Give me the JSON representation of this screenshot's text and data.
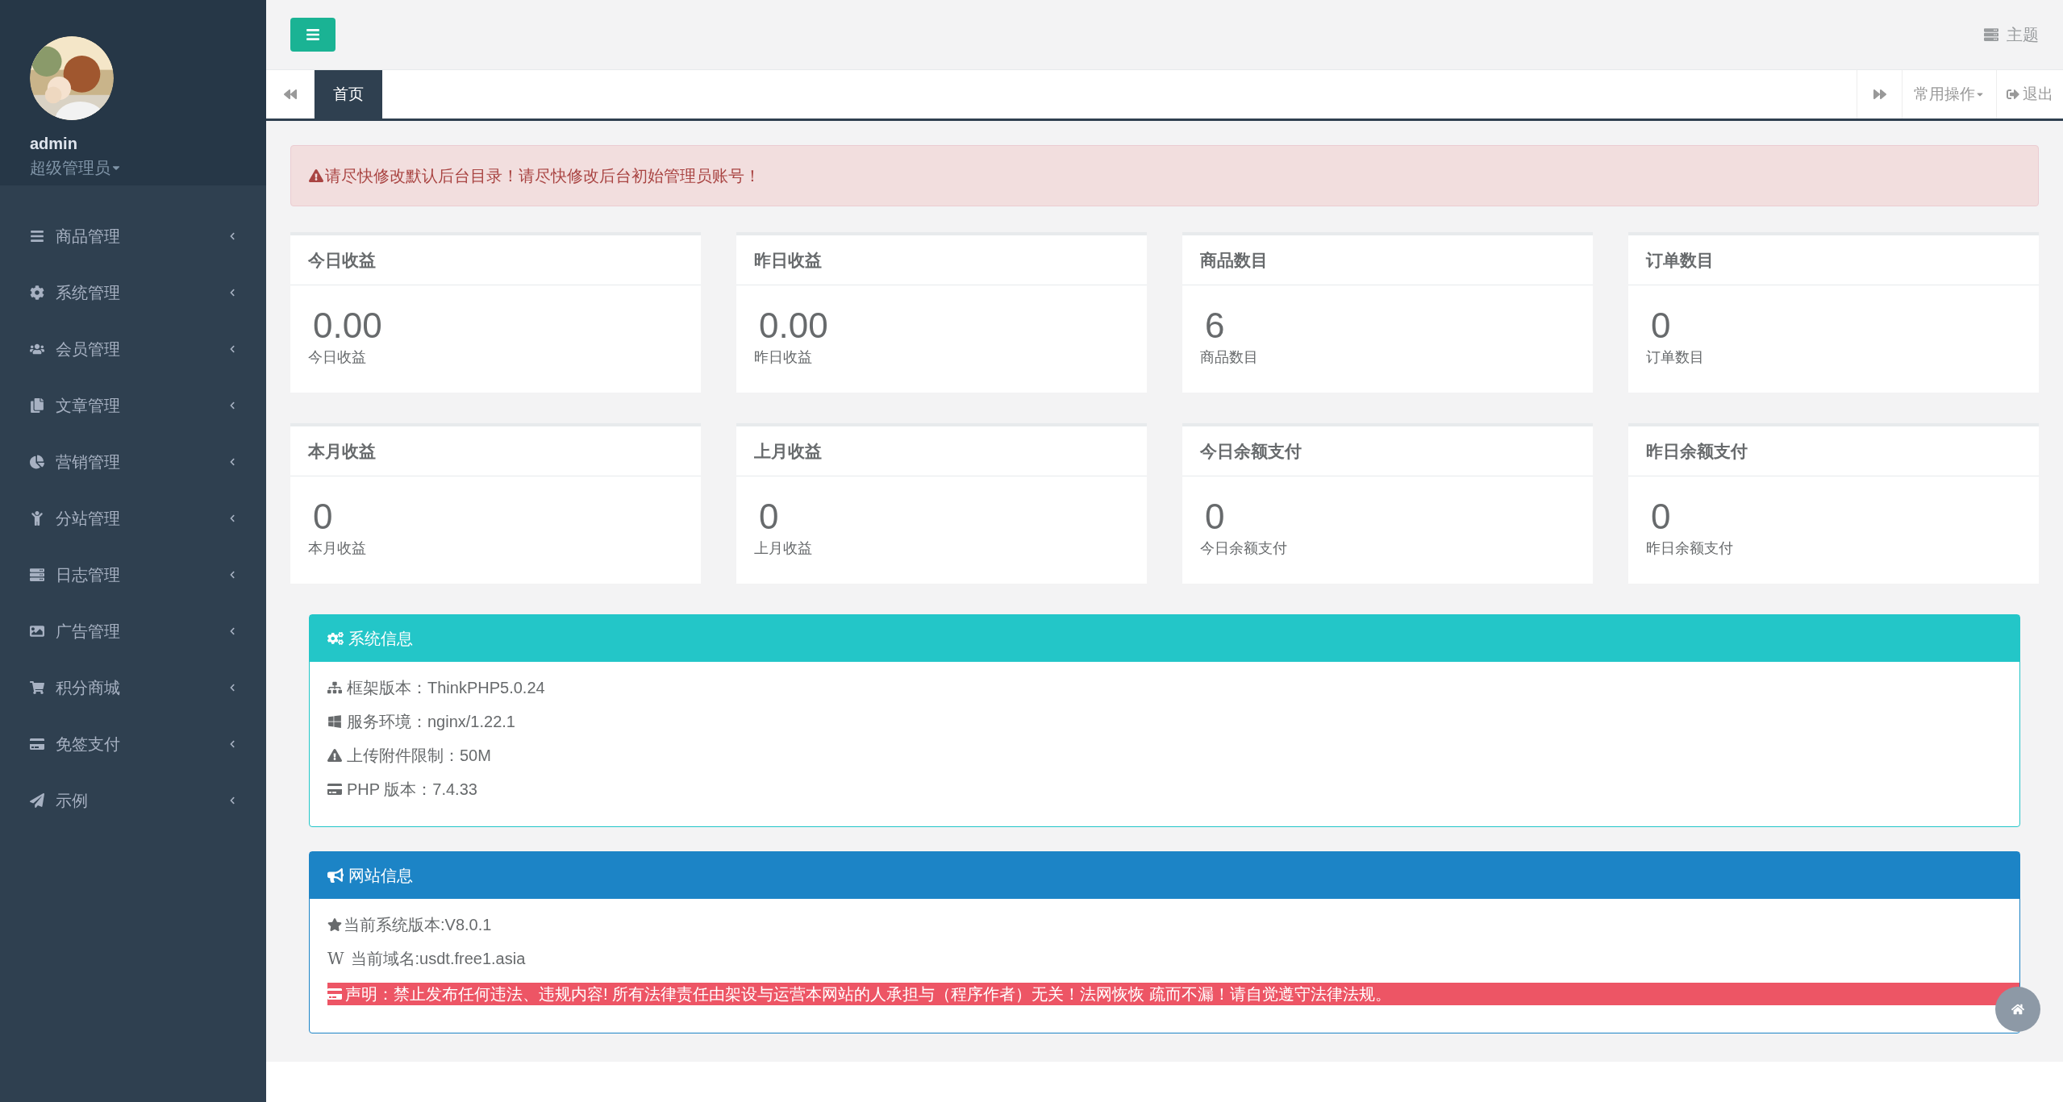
{
  "user": {
    "name": "admin",
    "role": "超级管理员"
  },
  "sidebar": {
    "items": [
      {
        "label": "商品管理"
      },
      {
        "label": "系统管理"
      },
      {
        "label": "会员管理"
      },
      {
        "label": "文章管理"
      },
      {
        "label": "营销管理"
      },
      {
        "label": "分站管理"
      },
      {
        "label": "日志管理"
      },
      {
        "label": "广告管理"
      },
      {
        "label": "积分商城"
      },
      {
        "label": "免签支付"
      },
      {
        "label": "示例"
      }
    ]
  },
  "topbar": {
    "theme": "主题"
  },
  "tabs": [
    {
      "label": "首页",
      "selected": true
    }
  ],
  "tab_actions": {
    "menu": "常用操作",
    "logout": "退出"
  },
  "alert": "请尽快修改默认后台目录！请尽快修改后台初始管理员账号！",
  "stats": [
    {
      "title": "今日收益",
      "value": "0.00",
      "label": "今日收益"
    },
    {
      "title": "昨日收益",
      "value": "0.00",
      "label": "昨日收益"
    },
    {
      "title": "商品数目",
      "value": "6",
      "label": "商品数目"
    },
    {
      "title": "订单数目",
      "value": "0",
      "label": "订单数目"
    },
    {
      "title": "本月收益",
      "value": "0",
      "label": "本月收益"
    },
    {
      "title": "上月收益",
      "value": "0",
      "label": "上月收益"
    },
    {
      "title": "今日余额支付",
      "value": "0",
      "label": "今日余额支付"
    },
    {
      "title": "昨日余额支付",
      "value": "0",
      "label": "昨日余额支付"
    }
  ],
  "system_info": {
    "title": "系统信息",
    "lines": [
      {
        "text": "框架版本：ThinkPHP5.0.24"
      },
      {
        "text": "服务环境：nginx/1.22.1"
      },
      {
        "text": "上传附件限制：50M"
      },
      {
        "text": "PHP 版本：7.4.33"
      }
    ]
  },
  "site_info": {
    "title": "网站信息",
    "lines": [
      {
        "text": "当前系统版本:V8.0.1",
        "kind": "plain"
      },
      {
        "text": "W",
        "text2": "当前域名:usdt.free1.asia",
        "kind": "letter"
      },
      {
        "text": "声明：禁止发布任何违法、违规内容! 所有法律责任由架设与运营本网站的人承担与（程序作者）无关！法网恢恢 疏而不漏！请自觉遵守法律法规。",
        "kind": "danger"
      }
    ]
  }
}
